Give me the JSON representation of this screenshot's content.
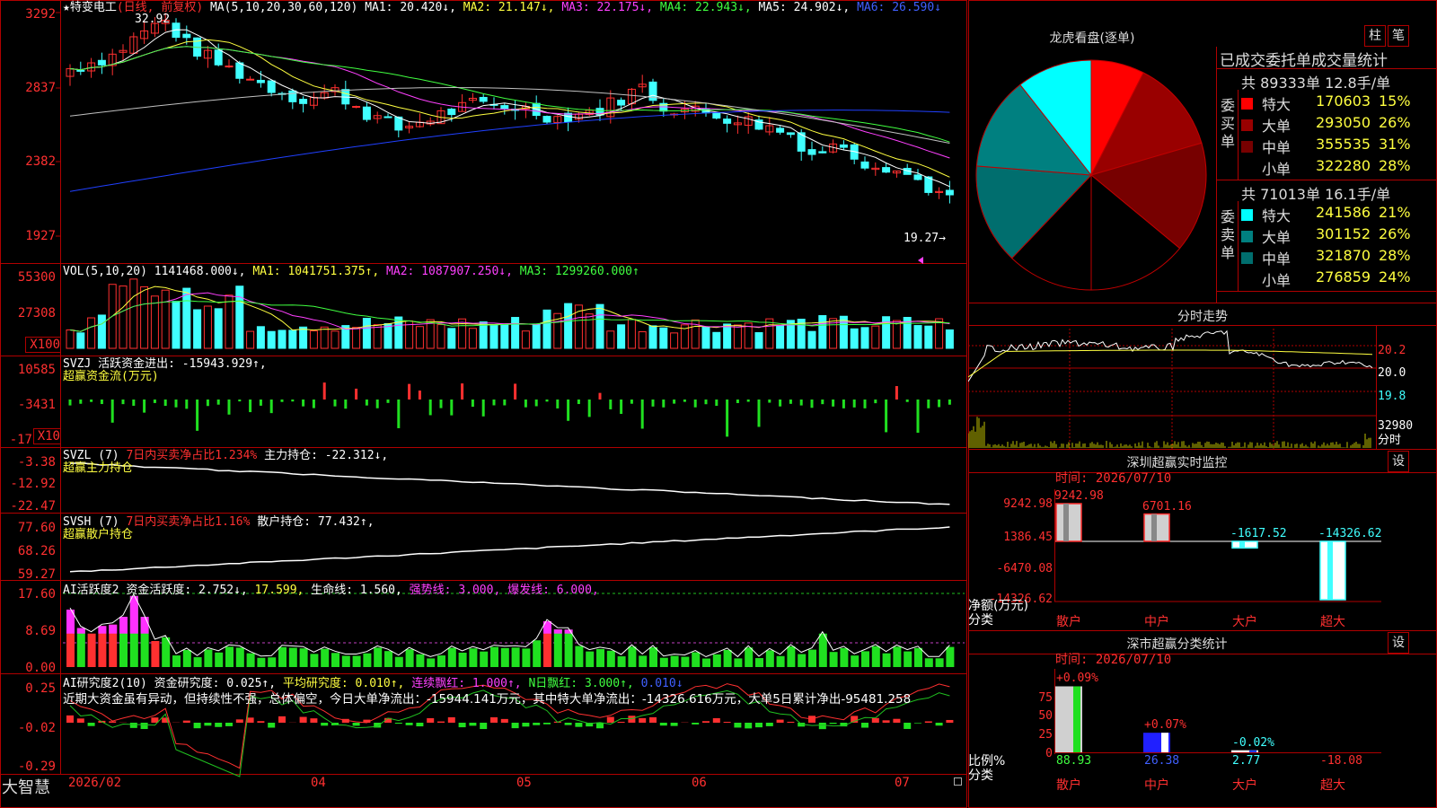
{
  "colors": {
    "up": "#ff3030",
    "down": "#40ffff",
    "bg": "#000000",
    "grid": "#b00000",
    "ma1": "#ffffff",
    "ma2": "#ffff40",
    "ma3": "#ff40ff",
    "ma4": "#40ff40",
    "ma5": "#c0c0c0",
    "ma6": "#2040ff"
  },
  "header": {
    "star": "★",
    "name": "特变电工",
    "period": "(日线, 前复权)",
    "ma_label": "MA(5,10,20,30,60,120)",
    "ma1": "MA1: 20.420↓,",
    "ma2": "MA2: 21.147↓,",
    "ma3": "MA3: 22.175↓,",
    "ma4": "MA4: 22.943↓,",
    "ma5": "MA5: 24.902↓,",
    "ma6": "MA6: 26.590↓"
  },
  "price_axis": [
    "3292",
    "2837",
    "2382",
    "1927"
  ],
  "price_high_label": "32.92",
  "price_low_label": "19.27→",
  "vol_header": {
    "name": "VOL(5,10,20)",
    "v": "1141468.000↓,",
    "ma1": "MA1: 1041751.375↑,",
    "ma2": "MA2: 1087907.250↓,",
    "ma3": "MA3: 1299260.000↑"
  },
  "vol_axis": [
    "55300",
    "27308",
    "X100"
  ],
  "svzj": {
    "name": "SVZJ",
    "label": "活跃资金进出: -15943.929↑,",
    "sub": "超赢资金流(万元)",
    "axis": [
      "10585",
      "-3431",
      "-17",
      "X10"
    ]
  },
  "svzl": {
    "name": "SVZL (7)",
    "p1": "7日内买卖净占比1.234%",
    "p2": "主力持仓: -22.312↓,",
    "sub": "超赢主力持仓",
    "axis": [
      "-3.38",
      "-12.92",
      "-22.47"
    ]
  },
  "svsh": {
    "name": "SVSH (7)",
    "p1": "7日内买卖净占比1.16%",
    "p2": "散户持仓: 77.432↑,",
    "sub": "超赢散户持仓",
    "axis": [
      "77.60",
      "68.26",
      "59.27"
    ]
  },
  "ai_active": {
    "name": "AI活跃度2",
    "a": "资金活跃度: 2.752↓,",
    "b": "17.599,",
    "c": "生命线: 1.560,",
    "d": "强势线: 3.000,",
    "e": "爆发线: 6.000,",
    "axis": [
      "17.60",
      "8.69",
      "0.00"
    ]
  },
  "ai_research": {
    "name": "AI研究度2(10)",
    "a": "资金研究度: 0.025↑,",
    "b": "平均研究度: 0.010↑,",
    "c": "连续飘红: 1.000↑,",
    "d": "N日飘红: 3.000↑,",
    "e": "0.010↓",
    "note": "近期大资金虽有异动，但持续性不强，总体偏空，今日大单净流出：-15944.141万元，其中特大单净流出：-14326.616万元，大单5日累计净出-95481.258",
    "axis": [
      "0.25",
      "-0.02",
      "-0.29"
    ]
  },
  "date_axis": {
    "brand": "大智慧",
    "labels": [
      "2026/02",
      "04",
      "05",
      "06",
      "07"
    ]
  },
  "right": {
    "lhb_title": "龙虎看盘(逐单)",
    "btn_zhu": "柱",
    "btn_bi": "笔",
    "stats_title": "已成交委托单成交量统计",
    "buy": {
      "side": "委买单",
      "total": "共 89333单 12.8手/单",
      "rows": [
        {
          "k": "特大",
          "v": "170603",
          "p": "15%",
          "c": "#ff0000"
        },
        {
          "k": "大单",
          "v": "293050",
          "p": "26%",
          "c": "#990000"
        },
        {
          "k": "中单",
          "v": "355535",
          "p": "31%",
          "c": "#770000"
        },
        {
          "k": "小单",
          "v": "322280",
          "p": "28%",
          "c": "#000000"
        }
      ]
    },
    "sell": {
      "side": "委卖单",
      "total": "共 71013单 16.1手/单",
      "rows": [
        {
          "k": "特大",
          "v": "241586",
          "p": "21%",
          "c": "#00ffff"
        },
        {
          "k": "大单",
          "v": "301152",
          "p": "26%",
          "c": "#008080"
        },
        {
          "k": "中单",
          "v": "321870",
          "p": "28%",
          "c": "#006e6e"
        },
        {
          "k": "小单",
          "v": "276859",
          "p": "24%",
          "c": "#000000"
        }
      ]
    },
    "fenshi_title": "分时走势",
    "fenshi_axis": [
      "20.2",
      "20.0",
      "19.8",
      "32980",
      "分时"
    ],
    "sz_title": "深圳超赢实时监控",
    "btn_set1": "设",
    "sz_time": "时间: 2026/07/10",
    "sz_axis": [
      "9242.98",
      "1386.45",
      "-6470.08",
      "-14326.62"
    ],
    "sz_unit": "净额(万元)",
    "sz_cat_label": "分类",
    "sz_bars": [
      {
        "cat": "散户",
        "v": 9242.98,
        "label": "9242.98"
      },
      {
        "cat": "中户",
        "v": 6701.16,
        "label": "6701.16"
      },
      {
        "cat": "大户",
        "v": -1617.52,
        "label": "-1617.52"
      },
      {
        "cat": "超大",
        "v": -14326.62,
        "label": "-14326.62"
      }
    ],
    "ss_title": "深市超赢分类统计",
    "btn_set2": "设",
    "ss_time": "时间: 2026/07/10",
    "ss_axis": [
      "75",
      "50",
      "25",
      "0"
    ],
    "ss_unit": "比例%",
    "ss_cat_label": "分类",
    "ss_bars": [
      {
        "cat": "散户",
        "v": 88.93,
        "top": "+0.09%",
        "bottom": "88.93"
      },
      {
        "cat": "中户",
        "v": 26.38,
        "top": "+0.07%",
        "bottom": "26.38"
      },
      {
        "cat": "大户",
        "v": 2.77,
        "top": "-0.02%",
        "bottom": "2.77"
      },
      {
        "cat": "超大",
        "v": -18.08,
        "top": "",
        "bottom": "-18.08"
      }
    ]
  }
}
